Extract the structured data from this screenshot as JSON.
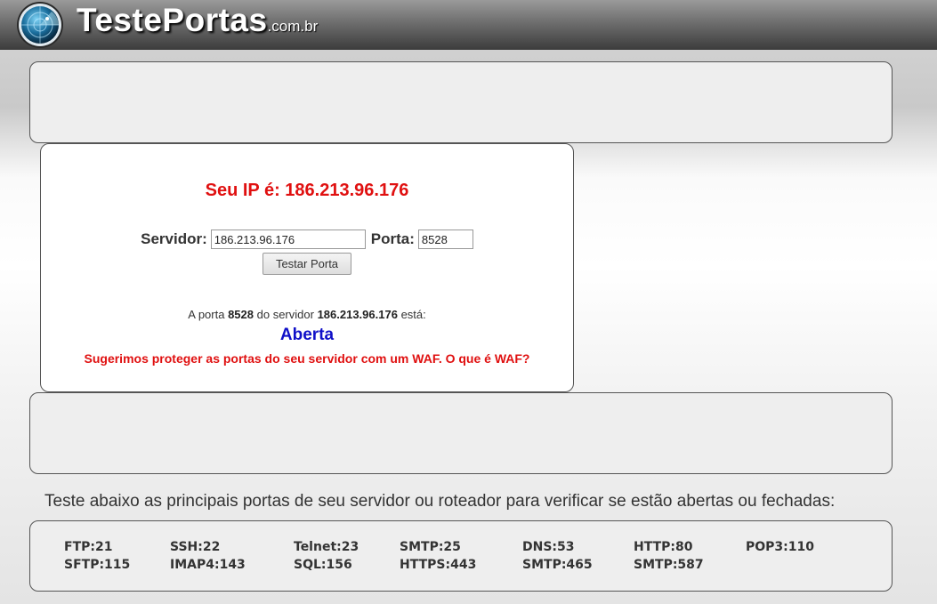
{
  "header": {
    "logo_text": "TestePortas",
    "logo_suffix": ".com.br",
    "logo_icon": "radar-globe-icon"
  },
  "main": {
    "ip_title": "Seu IP é: 186.213.96.176",
    "server_label": "Servidor:",
    "server_value": "186.213.96.176",
    "port_label": "Porta:",
    "port_value": "8528",
    "test_button": "Testar Porta",
    "result_prefix": "A porta",
    "result_port": "8528",
    "result_middle": "do servidor",
    "result_server": "186.213.96.176",
    "result_suffix": "está:",
    "status": "Aberta",
    "waf_message": "Sugerimos proteger as portas do seu servidor com um WAF. O que é WAF?"
  },
  "ports": {
    "intro": "Teste abaixo as principais portas de seu servidor ou roteador para verificar se estão abertas ou fechadas:",
    "row1": [
      "FTP:21",
      "SSH:22",
      "Telnet:23",
      "SMTP:25",
      "DNS:53",
      "HTTP:80",
      "POP3:110"
    ],
    "row2": [
      "SFTP:115",
      "IMAP4:143",
      "SQL:156",
      "HTTPS:443",
      "SMTP:465",
      "SMTP:587"
    ]
  },
  "colors": {
    "ip_title": "#e01010",
    "status_open": "#1010c8",
    "waf_message": "#e01010"
  }
}
